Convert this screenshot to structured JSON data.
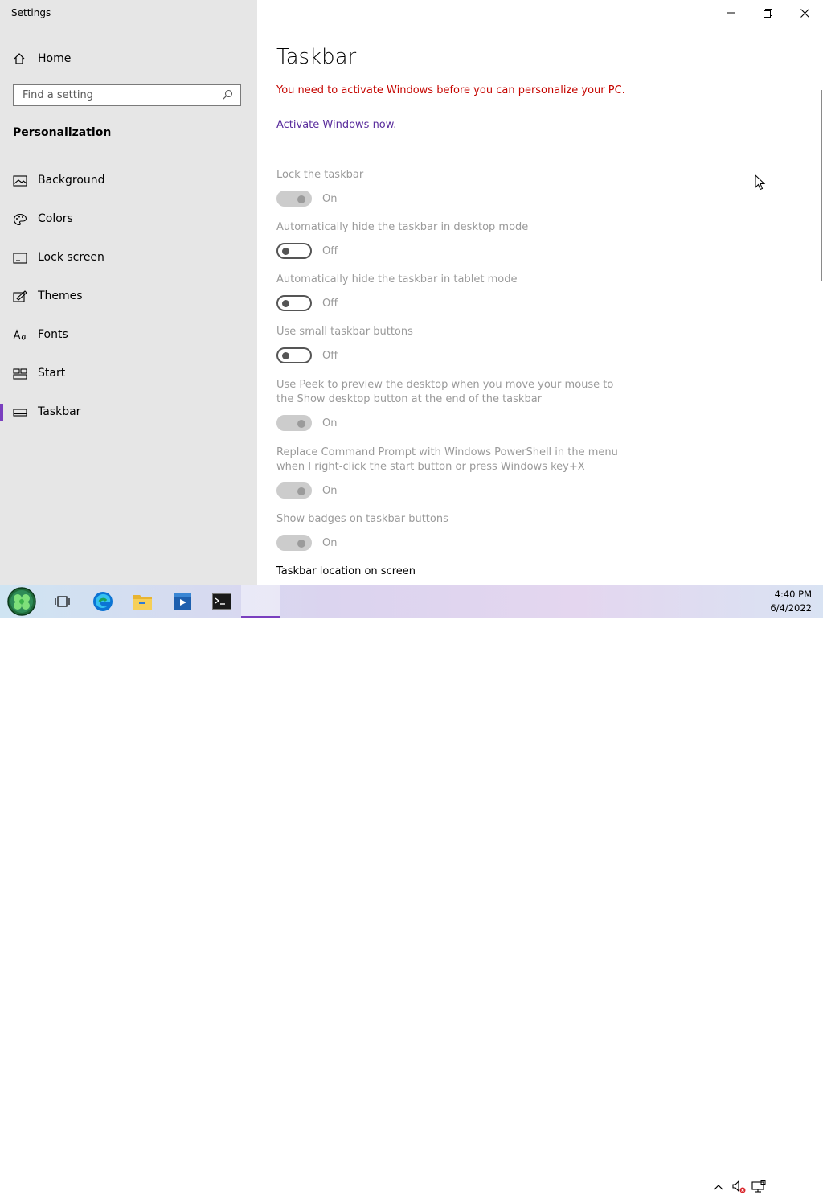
{
  "app": {
    "title": "Settings"
  },
  "sidebar": {
    "home_label": "Home",
    "search": {
      "placeholder": "Find a setting",
      "value": ""
    },
    "section_title": "Personalization",
    "items": [
      {
        "label": "Background",
        "icon": "picture-icon"
      },
      {
        "label": "Colors",
        "icon": "palette-icon"
      },
      {
        "label": "Lock screen",
        "icon": "lock-screen-icon"
      },
      {
        "label": "Themes",
        "icon": "themes-icon"
      },
      {
        "label": "Fonts",
        "icon": "fonts-icon"
      },
      {
        "label": "Start",
        "icon": "start-icon"
      },
      {
        "label": "Taskbar",
        "icon": "taskbar-icon",
        "selected": true
      }
    ]
  },
  "main": {
    "title": "Taskbar",
    "warning": "You need to activate Windows before you can personalize your PC.",
    "activate_link": "Activate Windows now.",
    "settings": [
      {
        "label": "Lock the taskbar",
        "state": "On"
      },
      {
        "label": "Automatically hide the taskbar in desktop mode",
        "state": "Off"
      },
      {
        "label": "Automatically hide the taskbar in tablet mode",
        "state": "Off"
      },
      {
        "label": "Use small taskbar buttons",
        "state": "Off"
      },
      {
        "label": "Use Peek to preview the desktop when you move your mouse to the Show desktop button at the end of the taskbar",
        "state": "On"
      },
      {
        "label": "Replace Command Prompt with Windows PowerShell in the menu when I right-click the start button or press Windows key+X",
        "state": "On"
      },
      {
        "label": "Show badges on taskbar buttons",
        "state": "On"
      }
    ],
    "subheading": "Taskbar location on screen"
  },
  "taskbar": {
    "time": "4:40 PM",
    "date": "6/4/2022",
    "apps": [
      "start-orb-icon",
      "task-view-icon",
      "edge-icon",
      "file-explorer-icon",
      "media-player-icon",
      "terminal-icon",
      "settings-app-icon"
    ]
  },
  "colors": {
    "accent": "#7a3fbf",
    "warning": "#c50500",
    "link": "#5a2d9c",
    "sidebar_bg": "#e6e6e6"
  }
}
